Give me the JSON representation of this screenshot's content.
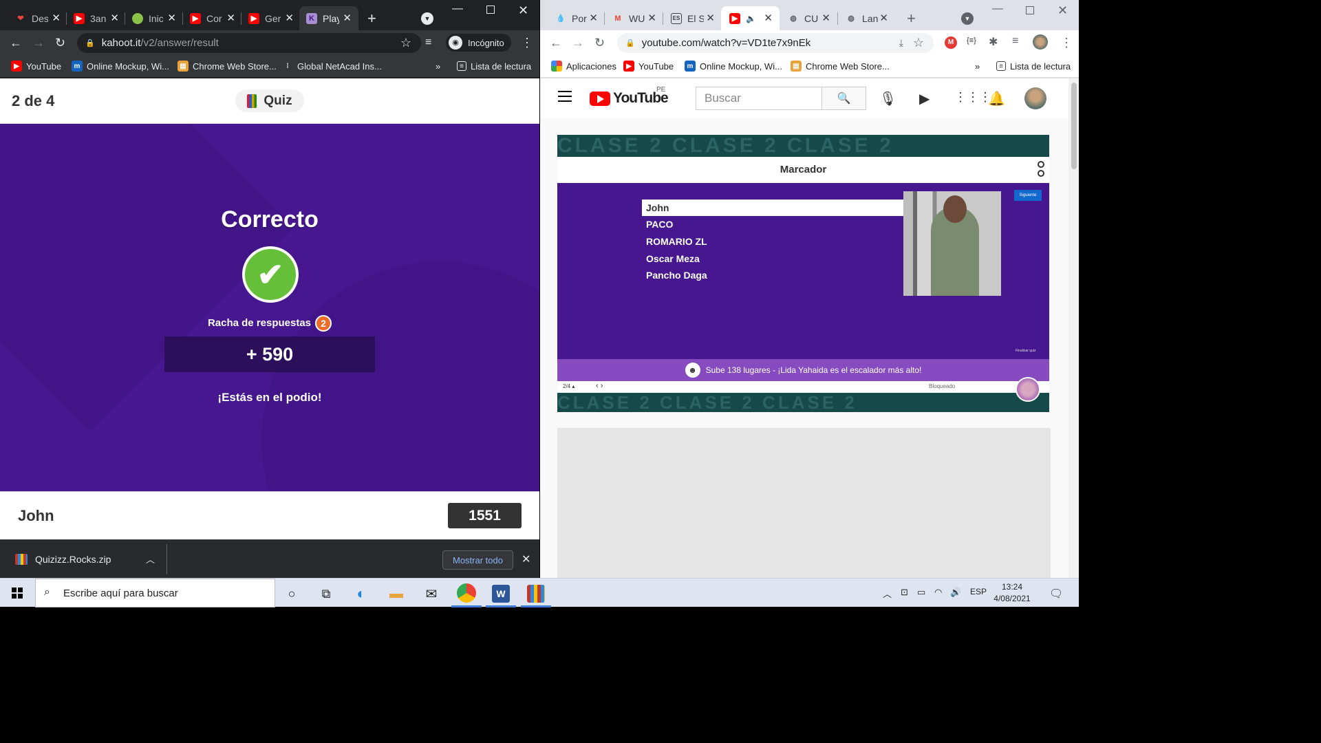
{
  "left_browser": {
    "tabs": [
      {
        "title": "Des"
      },
      {
        "title": "3an"
      },
      {
        "title": "Inic"
      },
      {
        "title": "Cor"
      },
      {
        "title": "Ger"
      },
      {
        "title": "Play"
      }
    ],
    "url_host": "kahoot.it",
    "url_path": "/v2/answer/result",
    "incognito_label": "Incógnito",
    "bookmarks": [
      "YouTube",
      "Online Mockup, Wi...",
      "Chrome Web Store...",
      "Global NetAcad Ins..."
    ],
    "reading_list": "Lista de lectura",
    "more": "»"
  },
  "kahoot": {
    "counter": "2 de 4",
    "quiz_label": "Quiz",
    "result_title": "Correcto",
    "streak_label": "Racha de respuestas",
    "streak_count": "2",
    "points": "+ 590",
    "podium_message": "¡Estás en el podio!",
    "player_name": "John",
    "player_score": "1551"
  },
  "download_bar": {
    "file_name": "Quizizz.Rocks.zip",
    "show_all": "Mostrar todo"
  },
  "right_browser": {
    "tabs": [
      {
        "title": "Por"
      },
      {
        "title": "WU"
      },
      {
        "title": "El S"
      },
      {
        "title": ""
      },
      {
        "title": "CU"
      },
      {
        "title": "Lan"
      }
    ],
    "url": "youtube.com/watch?v=VD1te7x9nEk",
    "bookmarks": [
      "Aplicaciones",
      "YouTube",
      "Online Mockup, Wi...",
      "Chrome Web Store..."
    ],
    "reading_list": "Lista de lectura",
    "more": "»"
  },
  "youtube": {
    "logo_text": "YouTube",
    "region": "PE",
    "search_placeholder": "Buscar",
    "video": {
      "band_text": "CLASE 2   CLASE 2   CLASE 2",
      "scoreboard_title": "Marcador",
      "players": [
        "John",
        "PACO",
        "ROMARIO ZL",
        "Oscar Meza",
        "Pancho Daga"
      ],
      "banner_text": "Sube 138 lugares - ¡Lida Yahaida es el escalador más alto!",
      "page_indicator": "2/4 ▴",
      "locked_label": "Bloqueado",
      "next_label": "Siguiente",
      "finish_label": "Finalizar quiz"
    }
  },
  "taskbar": {
    "search_placeholder": "Escribe aquí para buscar",
    "language": "ESP",
    "time": "13:24",
    "date": "4/08/2021"
  }
}
